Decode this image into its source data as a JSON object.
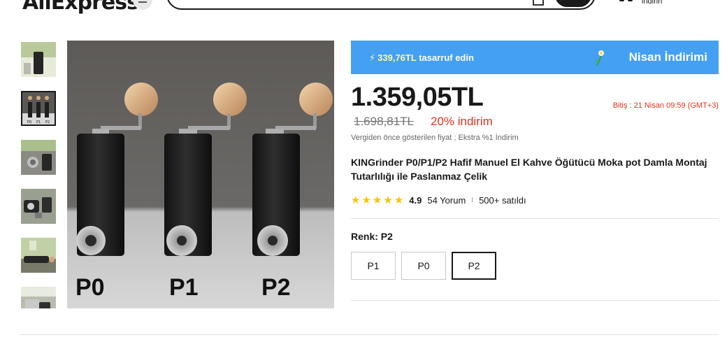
{
  "header": {
    "logo": "AliExpress",
    "app_text": "indirin"
  },
  "gallery": {
    "thumbnail_count": 6,
    "active_index": 1,
    "labels": [
      "P0",
      "P1",
      "P2"
    ]
  },
  "promo": {
    "amount": "339,76TL",
    "text": "tasarruf edin",
    "event": "Nisan İndirimi"
  },
  "price": {
    "current": "1.359,05TL",
    "original": "1.698,81TL",
    "discount": "20% indirim",
    "note": "Vergiden önce gösterilen fiyat ; Ekstra %1 İndirim",
    "countdown": "Bitiş :  21 Nisan 09:59 (GMT+3)"
  },
  "product": {
    "title": "KINGrinder P0/P1/P2 Hafif Manuel El Kahve Öğütücü Moka pot Damla Montaj Tutarlılığı ile Paslanmaz Çelik",
    "rating": "4.9",
    "rating_fraction": 0.98,
    "reviews": "54 Yorum",
    "separator": "I",
    "sold": "500+ satıldı"
  },
  "variants": {
    "label": "Renk: P2",
    "options": [
      "P1",
      "P0",
      "P2"
    ],
    "selected": "P2"
  },
  "colors": {
    "accent_red": "#e0321e",
    "promo_blue": "#44a0f2",
    "star_yellow": "#fdc300",
    "text_dark": "#191919"
  }
}
